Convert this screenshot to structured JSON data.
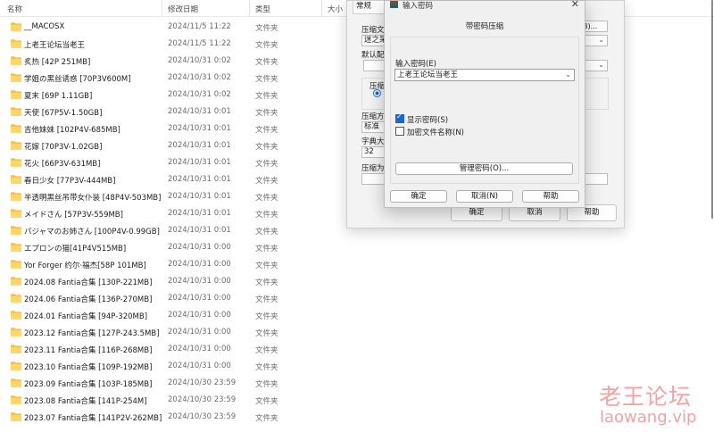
{
  "columns": {
    "name": "名称",
    "date": "修改日期",
    "type": "类型",
    "size": "大小"
  },
  "files": [
    {
      "name": "__MACOSX",
      "date": "2024/11/5 11:22",
      "type": "文件夹"
    },
    {
      "name": "上老王论坛当老王",
      "date": "2024/11/5 11:22",
      "type": "文件夹"
    },
    {
      "name": "炙热 [42P 251MB]",
      "date": "2024/10/31 0:02",
      "type": "文件夹"
    },
    {
      "name": "学姐の黑丝诱惑 [70P3V600M]",
      "date": "2024/10/31 0:02",
      "type": "文件夹"
    },
    {
      "name": "夏末 [69P 1.11GB]",
      "date": "2024/10/31 0:02",
      "type": "文件夹"
    },
    {
      "name": "天使 [67P5V-1.50GB]",
      "date": "2024/10/31 0:01",
      "type": "文件夹"
    },
    {
      "name": "吉他妹妹 [102P4V-685MB]",
      "date": "2024/10/31 0:01",
      "type": "文件夹"
    },
    {
      "name": "花嫁 [70P3V-1.02GB]",
      "date": "2024/10/31 0:01",
      "type": "文件夹"
    },
    {
      "name": "花火 [66P3V-631MB]",
      "date": "2024/10/31 0:01",
      "type": "文件夹"
    },
    {
      "name": "春日少女 [77P3V-444MB]",
      "date": "2024/10/31 0:01",
      "type": "文件夹"
    },
    {
      "name": "半透明黑丝吊带女仆装 [48P4V-503MB]",
      "date": "2024/10/31 0:01",
      "type": "文件夹"
    },
    {
      "name": "メイドさん [57P3V-559MB]",
      "date": "2024/10/31 0:01",
      "type": "文件夹"
    },
    {
      "name": "パジャマのお姉さん [100P4V-0.99GB]",
      "date": "2024/10/31 0:01",
      "type": "文件夹"
    },
    {
      "name": "エプロンの猫[41P4V515MB]",
      "date": "2024/10/31 0:00",
      "type": "文件夹"
    },
    {
      "name": "Yor Forger 约尔·福杰[58P 101MB]",
      "date": "2024/10/31 0:00",
      "type": "文件夹"
    },
    {
      "name": "2024.08 Fantia合集 [130P-221MB]",
      "date": "2024/10/31 0:00",
      "type": "文件夹"
    },
    {
      "name": "2024.06 Fantia合集 [136P-270MB]",
      "date": "2024/10/31 0:00",
      "type": "文件夹"
    },
    {
      "name": "2024.01 Fantia合集 [94P-320MB]",
      "date": "2024/10/31 0:00",
      "type": "文件夹"
    },
    {
      "name": "2023.12 Fantia合集 [127P-243.5MB]",
      "date": "2024/10/31 0:00",
      "type": "文件夹"
    },
    {
      "name": "2023.11 Fantia合集 [116P-268MB]",
      "date": "2024/10/31 0:00",
      "type": "文件夹"
    },
    {
      "name": "2023.10 Fantia合集 [109P-192MB]",
      "date": "2024/10/31 0:00",
      "type": "文件夹"
    },
    {
      "name": "2023.09 Fantia合集 [103P-185MB]",
      "date": "2024/10/30 23:59",
      "type": "文件夹"
    },
    {
      "name": "2023.08 Fantia合集 [141P-254M]",
      "date": "2024/10/30 23:59",
      "type": "文件夹"
    },
    {
      "name": "2023.07 Fantia合集 [141P2V-262MB]",
      "date": "2024/10/30 23:59",
      "type": "文件夹"
    }
  ],
  "bg_dialog": {
    "tab_general": "常规",
    "label_archive": "压缩文",
    "field_archive": "迷之呆",
    "field_archive_suffix": "B)...",
    "label_default": "默认配",
    "label_format": "压缩",
    "label_method": "压缩方",
    "field_method": "标准",
    "label_dict": "字典大",
    "field_dict": "32",
    "label_split": "压缩为",
    "ok": "确定",
    "cancel": "取消",
    "help": "帮助"
  },
  "pw_dialog": {
    "title": "输入密码",
    "heading": "带密码压缩",
    "label": "输入密码(E)",
    "value": "上老王论坛当老王",
    "show_password": "显示密码(S)",
    "encrypt_names": "加密文件名称(N)",
    "show_password_checked": true,
    "encrypt_names_checked": false,
    "manage": "管理密码(O)...",
    "ok": "确定",
    "cancel": "取消(N)",
    "help": "帮助"
  },
  "watermark": {
    "cn": "老王论坛",
    "url": "laowang.vip"
  }
}
